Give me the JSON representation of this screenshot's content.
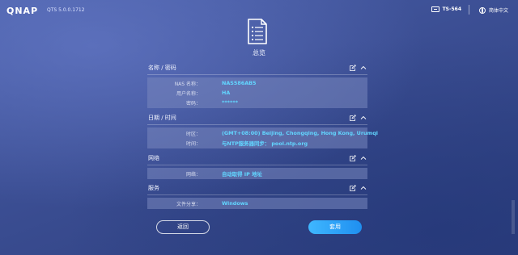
{
  "topbar": {
    "logo": "QNAP",
    "version": "QTS 5.0.0.1712",
    "model": "TS-564",
    "language": "简体中文"
  },
  "page": {
    "title": "总览"
  },
  "sections": [
    {
      "title": "名称 / 密码",
      "rows": [
        {
          "label": "NAS 名称：",
          "value": "NAS586AB5"
        },
        {
          "label": "用户名称：",
          "value": "HA"
        },
        {
          "label": "密码：",
          "value": "******"
        }
      ]
    },
    {
      "title": "日期 / 时间",
      "rows": [
        {
          "label": "时区：",
          "value": "(GMT+08:00) Beijing, Chongqing, Hong Kong, Urumqi"
        },
        {
          "label": "时间：",
          "value": "与NTP服务器同步： pool.ntp.org"
        }
      ]
    },
    {
      "title": "网络",
      "rows": [
        {
          "label": "网络：",
          "value": "自动取得 IP 地址"
        }
      ]
    },
    {
      "title": "服务",
      "rows": [
        {
          "label": "文件分享：",
          "value": "Windows"
        }
      ]
    }
  ],
  "buttons": {
    "back": "返回",
    "apply": "套用"
  },
  "icons": {
    "edit": "pencil-square-icon",
    "collapse": "chevron-up-icon",
    "summary": "document-list-icon",
    "language": "globe-icon",
    "model": "nas-device-icon"
  },
  "colors": {
    "value_text": "#62d6ff",
    "apply_button": "#2a9cf6",
    "background": "#3b4e93"
  }
}
